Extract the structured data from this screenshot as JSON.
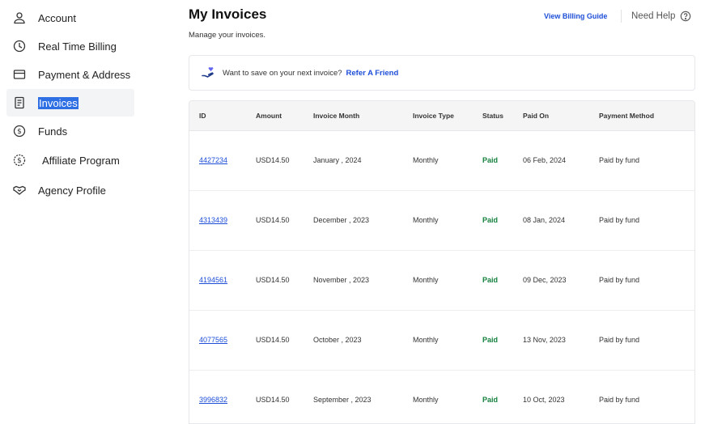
{
  "sidebar": {
    "items": [
      {
        "label": "Account",
        "icon": "user-icon"
      },
      {
        "label": "Real Time Billing",
        "icon": "clock-icon"
      },
      {
        "label": "Payment & Address",
        "icon": "credit-card-icon"
      },
      {
        "label": "Invoices",
        "icon": "receipt-icon"
      },
      {
        "label": "Funds",
        "icon": "dollar-circle-icon"
      },
      {
        "label": "Affiliate Program",
        "icon": "dollar-badge-icon"
      },
      {
        "label": "Agency Profile",
        "icon": "handshake-icon"
      }
    ]
  },
  "header": {
    "title": "My Invoices",
    "subtitle": "Manage your invoices.",
    "billing_guide_label": "View Billing Guide",
    "need_help_label": "Need Help"
  },
  "refer": {
    "text": "Want to save on your next invoice?",
    "link_label": "Refer A Friend"
  },
  "table": {
    "columns": [
      "ID",
      "Amount",
      "Invoice Month",
      "Invoice Type",
      "Status",
      "Paid On",
      "Payment Method"
    ],
    "rows": [
      {
        "id": "4427234",
        "amount": "USD14.50",
        "month": "January , 2024",
        "type": "Monthly",
        "status": "Paid",
        "paid_on": "06 Feb, 2024",
        "method": "Paid by fund"
      },
      {
        "id": "4313439",
        "amount": "USD14.50",
        "month": "December , 2023",
        "type": "Monthly",
        "status": "Paid",
        "paid_on": "08 Jan, 2024",
        "method": "Paid by fund"
      },
      {
        "id": "4194561",
        "amount": "USD14.50",
        "month": "November , 2023",
        "type": "Monthly",
        "status": "Paid",
        "paid_on": "09 Dec, 2023",
        "method": "Paid by fund"
      },
      {
        "id": "4077565",
        "amount": "USD14.50",
        "month": "October , 2023",
        "type": "Monthly",
        "status": "Paid",
        "paid_on": "13 Nov, 2023",
        "method": "Paid by fund"
      },
      {
        "id": "3996832",
        "amount": "USD14.50",
        "month": "September , 2023",
        "type": "Monthly",
        "status": "Paid",
        "paid_on": "10 Oct, 2023",
        "method": "Paid by fund"
      }
    ]
  },
  "colors": {
    "accent": "#1d4ed8",
    "paid": "#15803d",
    "selection": "#2f6fe4"
  }
}
